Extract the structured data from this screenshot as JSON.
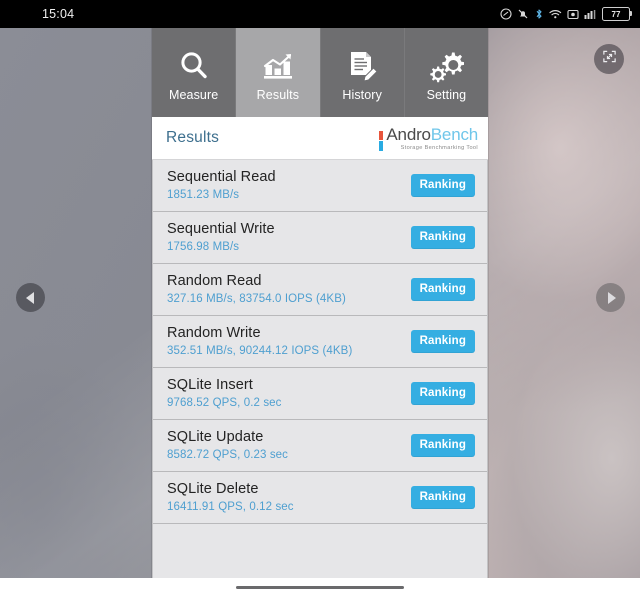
{
  "status_bar": {
    "time": "15:04",
    "icons": [
      {
        "name": "do-not-disturb-icon"
      },
      {
        "name": "notifications-off-icon"
      },
      {
        "name": "bluetooth-icon"
      },
      {
        "name": "wifi-icon"
      },
      {
        "name": "screenshot-icon"
      },
      {
        "name": "cellular-signal-icon"
      }
    ],
    "battery_percent": "77"
  },
  "overlay_controls": {
    "fullscreen_label": "fullscreen-toggle",
    "prev_label": "previous",
    "next_label": "next"
  },
  "tabs": [
    {
      "label": "Measure",
      "icon": "magnifier-icon",
      "active": false
    },
    {
      "label": "Results",
      "icon": "bar-chart-icon",
      "active": true
    },
    {
      "label": "History",
      "icon": "document-pencil-icon",
      "active": false
    },
    {
      "label": "Setting",
      "icon": "gears-icon",
      "active": false
    }
  ],
  "header": {
    "title": "Results",
    "brand_first": "Andro",
    "brand_second": "Bench",
    "brand_tagline": "Storage Benchmarking Tool"
  },
  "results": [
    {
      "name": "Sequential Read",
      "value": "1851.23 MB/s",
      "action": "Ranking"
    },
    {
      "name": "Sequential Write",
      "value": "1756.98 MB/s",
      "action": "Ranking"
    },
    {
      "name": "Random Read",
      "value": "327.16 MB/s, 83754.0 IOPS (4KB)",
      "action": "Ranking"
    },
    {
      "name": "Random Write",
      "value": "352.51 MB/s, 90244.12 IOPS (4KB)",
      "action": "Ranking"
    },
    {
      "name": "SQLite Insert",
      "value": "9768.52 QPS, 0.2 sec",
      "action": "Ranking"
    },
    {
      "name": "SQLite Update",
      "value": "8582.72 QPS, 0.23 sec",
      "action": "Ranking"
    },
    {
      "name": "SQLite Delete",
      "value": "16411.91 QPS, 0.12 sec",
      "action": "Ranking"
    }
  ],
  "colors": {
    "accent_blue": "#35aee2",
    "value_blue": "#4e9fd0",
    "tab_inactive": "#6e6e70",
    "tab_active": "#a7a7a9",
    "row_bg": "#e6e6e8",
    "brand_gray": "#4a4a4a",
    "brand_blue": "#6fc6ea",
    "brand_red": "#e8553c"
  }
}
